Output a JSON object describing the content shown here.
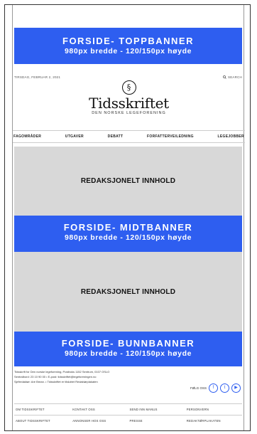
{
  "banners": {
    "top": {
      "title": "FORSIDE- TOPPBANNER",
      "size": "980px bredde - 120/150px høyde"
    },
    "middle": {
      "title": "FORSIDE- MIDTBANNER",
      "size": "980px bredde - 120/150px høyde"
    },
    "bottom": {
      "title": "FORSIDE- BUNNBANNER",
      "size": "980px bredde - 120/150px høyde"
    }
  },
  "header": {
    "date": "TIRSDAG, FEBRUAR 2, 2021",
    "search_label": "SEARCH",
    "logo_title": "Tidsskriftet",
    "logo_subtitle": "DEN NORSKE LEGEFORENING"
  },
  "nav": [
    "FAGOMRÅDER",
    "UTGAVER",
    "DEBATT",
    "FORFATTERVEILEDNING",
    "LEGEJOBBER"
  ],
  "content": {
    "block1": "REDAKSJONELT INNHOLD",
    "block2": "REDAKSJONELT INNHOLD"
  },
  "footer": {
    "info": [
      "Tidsskrift for Den norske legeforening, Postboks 1152 Sentrum, 0107 OSLO",
      "Sentralbord: 23 10 90 00 • E-post: tidsskriftet@legeforeningen.no",
      "Sjefredaktør: Are Brean. • Tidsskriftet er tilsluttet Redaktørplakaten"
    ],
    "follow_label": "FØLG OSS",
    "links": [
      "OM TIDSSKRIFTET",
      "KONTAKT OSS",
      "SEND INN MANUS",
      "PERSONVERN",
      "ABOUT TIDSSKRIFTET",
      "ANNONSER HOS OSS",
      "PRESSE",
      "REDAKTØRPLAKATEN"
    ]
  }
}
